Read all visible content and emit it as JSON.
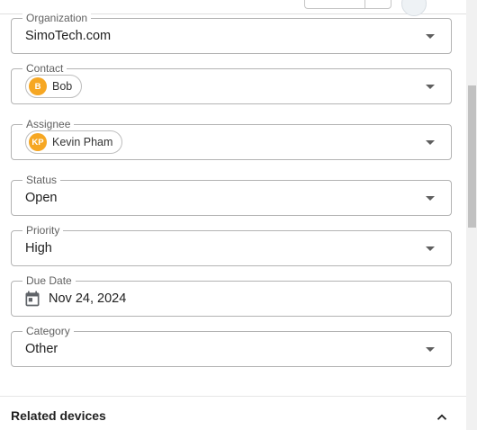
{
  "form": {
    "organization": {
      "label": "Organization",
      "value": "SimoTech.com"
    },
    "contact": {
      "label": "Contact",
      "chip": {
        "initials": "B",
        "name": "Bob"
      }
    },
    "assignee": {
      "label": "Assignee",
      "chip": {
        "initials": "KP",
        "name": "Kevin Pham"
      }
    },
    "status": {
      "label": "Status",
      "value": "Open"
    },
    "priority": {
      "label": "Priority",
      "value": "High"
    },
    "due_date": {
      "label": "Due Date",
      "value": "Nov 24, 2024"
    },
    "category": {
      "label": "Category",
      "value": "Other"
    }
  },
  "related_devices": {
    "title": "Related devices"
  },
  "icons": {
    "dropdown": "arrow-drop-down-icon",
    "calendar": "calendar-icon",
    "collapse": "chevron-up-icon"
  },
  "colors": {
    "avatar": "#f6a723",
    "border": "#b3b3b3",
    "label": "#616161"
  }
}
